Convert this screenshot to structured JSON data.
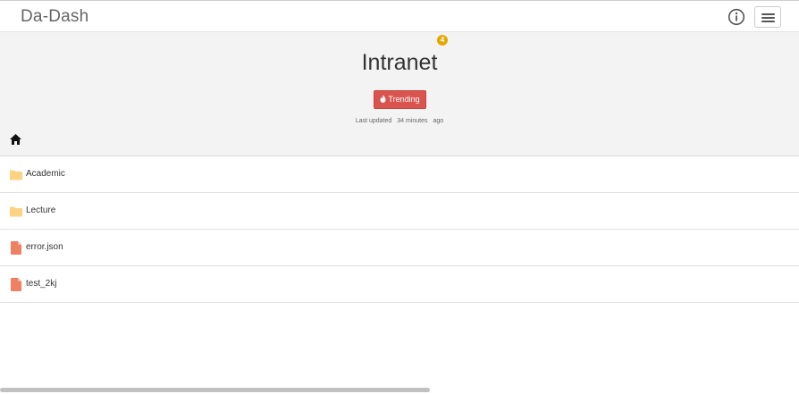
{
  "app": {
    "brand": "Da-Dash"
  },
  "header": {
    "info_icon": "info-circle-icon",
    "menu_icon": "hamburger-menu-icon"
  },
  "hero": {
    "title": "Intranet",
    "badge_count": "4",
    "trending_label": "Trending",
    "last_updated_label": "Last updated",
    "last_updated_value": "34 minutes",
    "last_updated_suffix": "ago"
  },
  "breadcrumb": {
    "home_icon": "home-icon"
  },
  "items": [
    {
      "name": "Academic",
      "type": "folder",
      "icon": "folder-icon"
    },
    {
      "name": "Lecture",
      "type": "folder",
      "icon": "folder-icon"
    },
    {
      "name": "error.json",
      "type": "file",
      "icon": "file-icon"
    },
    {
      "name": "test_2kj",
      "type": "file",
      "icon": "file-icon"
    }
  ],
  "colors": {
    "trending": "#d9534f",
    "badge": "#e6a700",
    "folder": "#fdd282",
    "file": "#ef8061"
  }
}
